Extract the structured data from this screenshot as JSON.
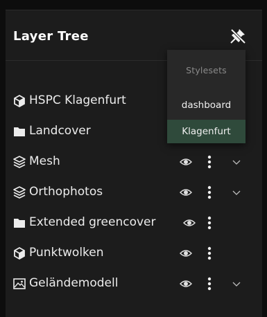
{
  "panel": {
    "title": "Layer Tree",
    "pin_icon": "pin-off-icon"
  },
  "layers": [
    {
      "label": "HSPC Klagenfurt",
      "icon": "cube-icon",
      "controls": false,
      "expandable": false
    },
    {
      "label": "Landcover",
      "icon": "folder-icon",
      "controls": false,
      "expandable": false
    },
    {
      "label": "Mesh",
      "icon": "layers-icon",
      "controls": true,
      "expandable": true
    },
    {
      "label": "Orthophotos",
      "icon": "layers-icon",
      "controls": true,
      "expandable": true
    },
    {
      "label": "Extended greencover",
      "icon": "folder-icon",
      "controls": true,
      "expandable": false
    },
    {
      "label": "Punktwolken",
      "icon": "cube-icon",
      "controls": true,
      "expandable": false
    },
    {
      "label": "Geländemodell",
      "icon": "image-icon",
      "controls": true,
      "expandable": true
    }
  ],
  "stylesets_menu": {
    "header": "Stylesets",
    "items": [
      {
        "label": "dashboard",
        "active": false
      },
      {
        "label": "Klagenfurt",
        "active": true
      }
    ]
  },
  "colors": {
    "panel_bg": "#1c1c1c",
    "text": "#ececec",
    "active_item_bg": "#2f4a3b"
  }
}
